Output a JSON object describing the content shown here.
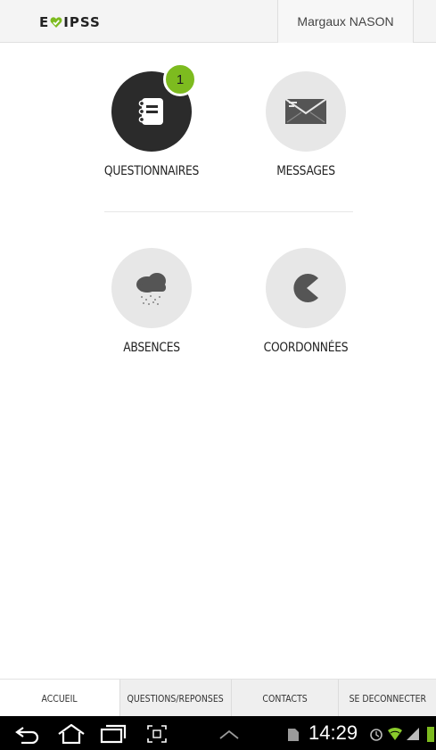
{
  "header": {
    "logo_left": "E",
    "logo_right": "IPSS",
    "user_name": "Margaux NASON"
  },
  "tiles": [
    {
      "label": "QUESTIONNAIRES",
      "icon": "notebook-icon",
      "badge": "1"
    },
    {
      "label": "MESSAGES",
      "icon": "envelope-icon"
    },
    {
      "label": "ABSENCES",
      "icon": "snow-cloud-icon"
    },
    {
      "label": "COORDONNÉES",
      "icon": "pacman-icon"
    }
  ],
  "tabs": [
    {
      "label": "ACCUEIL",
      "active": true
    },
    {
      "label": "QUESTIONS/REPONSES"
    },
    {
      "label": "CONTACTS"
    },
    {
      "label": "SE DECONNECTER"
    }
  ],
  "status_bar": {
    "time": "14:29"
  },
  "colors": {
    "accent": "#7dbb1f",
    "dark_circle": "#2b2b2b",
    "light_circle": "#e7e7e7"
  }
}
